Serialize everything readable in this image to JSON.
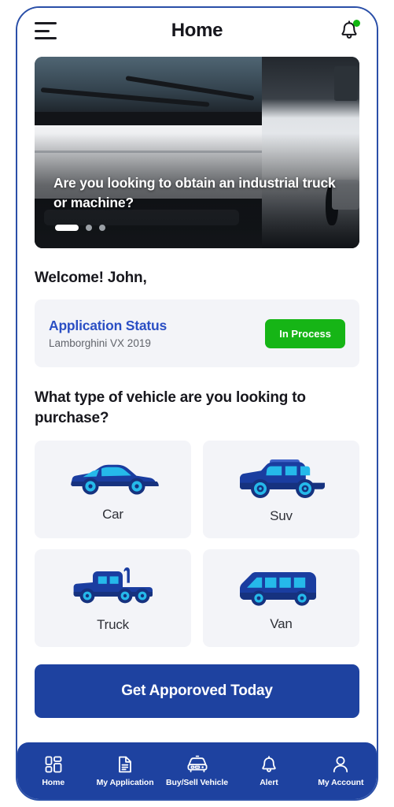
{
  "header": {
    "title": "Home",
    "menu_icon": "hamburger-menu-icon",
    "notification_icon": "bell-icon",
    "has_notification_dot": true
  },
  "banner": {
    "headline": "Are you looking to obtain an industrial truck or machine?",
    "carousel": {
      "total_dots": 3,
      "active_index": 0
    }
  },
  "welcome": {
    "greeting": "Welcome! John,"
  },
  "application_status": {
    "title": "Application Status",
    "vehicle": "Lamborghini VX 2019",
    "badge_label": "In Process",
    "badge_color": "#16b516"
  },
  "vehicle_section": {
    "question": "What type of vehicle are you looking to purchase?",
    "options": [
      {
        "label": "Car",
        "icon": "car-icon"
      },
      {
        "label": "Suv",
        "icon": "suv-icon"
      },
      {
        "label": "Truck",
        "icon": "truck-icon"
      },
      {
        "label": "Van",
        "icon": "van-icon"
      }
    ]
  },
  "cta": {
    "label": "Get Apporoved Today",
    "color": "#1e42a0"
  },
  "bottom_nav": {
    "items": [
      {
        "label": "Home",
        "icon": "dashboard-grid-icon"
      },
      {
        "label": "My Application",
        "icon": "document-icon"
      },
      {
        "label": "Buy/Sell Vehicle",
        "icon": "car-front-icon"
      },
      {
        "label": "Alert",
        "icon": "bell-icon"
      },
      {
        "label": "My Account",
        "icon": "person-icon"
      }
    ],
    "active": "Home",
    "background_color": "#1e42a0"
  },
  "theme": {
    "primary_blue": "#1e42a0",
    "link_blue": "#2b4fc4",
    "card_bg": "#f3f4f8",
    "icon_dark_blue": "#1a3da0",
    "icon_cyan": "#1fc8f0"
  }
}
